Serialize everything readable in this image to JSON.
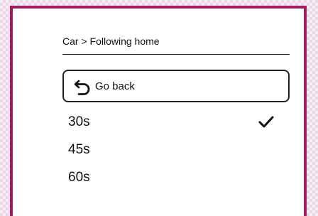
{
  "screen": {
    "breadcrumb": "Car > Following home",
    "back_button": {
      "label": "Go back",
      "icon": "undo-arrow-icon"
    },
    "options": [
      {
        "label": "30s",
        "selected": true
      },
      {
        "label": "45s",
        "selected": false
      },
      {
        "label": "60s",
        "selected": false
      }
    ],
    "selected_icon": "checkmark-icon"
  },
  "colors": {
    "frame_border": "#9b1f5e",
    "background_pattern": "#ead6e4",
    "text": "#111111"
  }
}
